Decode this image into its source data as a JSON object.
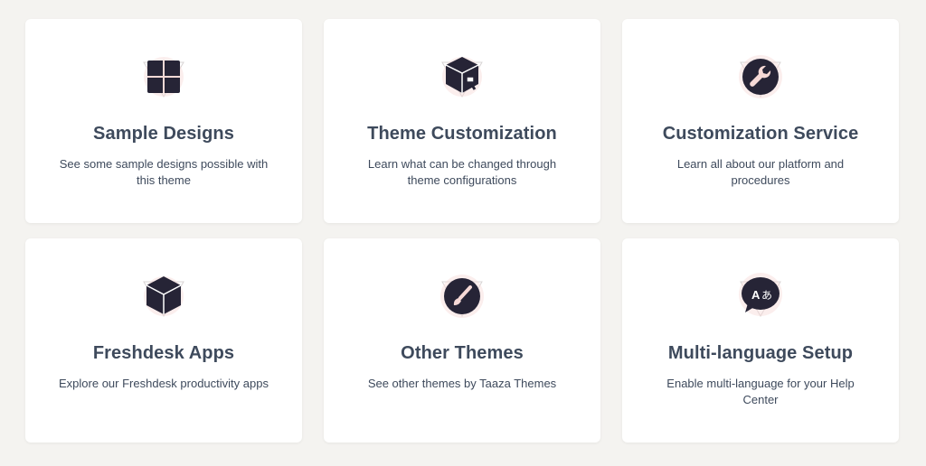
{
  "cards": [
    {
      "title": "Sample Designs",
      "desc": "See some sample designs possible with this theme",
      "icon": "grid-icon"
    },
    {
      "title": "Theme Customization",
      "desc": "Learn what can be changed through theme configurations",
      "icon": "box-brush-icon"
    },
    {
      "title": "Customization Service",
      "desc": "Learn all about our platform and procedures",
      "icon": "wrench-icon"
    },
    {
      "title": "Freshdesk Apps",
      "desc": "Explore our Freshdesk productivity apps",
      "icon": "cube-icon"
    },
    {
      "title": "Other Themes",
      "desc": "See other themes by Taaza Themes",
      "icon": "paintbrush-icon"
    },
    {
      "title": "Multi-language Setup",
      "desc": "Enable multi-language for your Help Center",
      "icon": "translate-icon"
    }
  ],
  "colors": {
    "page_bg": "#f4f3f0",
    "card_bg": "#ffffff",
    "icon_dark": "#262436",
    "icon_accent_pink": "#f6d9d6",
    "text": "#3e4a5c"
  }
}
